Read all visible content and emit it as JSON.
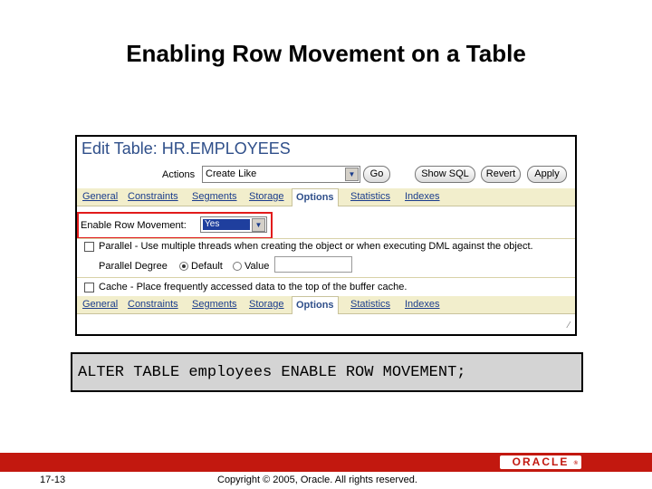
{
  "slide": {
    "title": "Enabling Row Movement on a Table",
    "page_number": "17-13",
    "copyright": "Copyright © 2005, Oracle.  All rights reserved.",
    "logo_text": "ORACLE"
  },
  "screenshot": {
    "title": "Edit Table: HR.EMPLOYEES",
    "actions_label": "Actions",
    "actions_value": "Create Like",
    "buttons": {
      "go": "Go",
      "show_sql": "Show SQL",
      "revert": "Revert",
      "apply": "Apply"
    },
    "tabs": [
      "General",
      "Constraints",
      "Segments",
      "Storage",
      "Options",
      "Statistics",
      "Indexes"
    ],
    "active_tab": "Options",
    "row_movement_label": "Enable Row Movement:",
    "row_movement_value": "Yes",
    "parallel_text": "Parallel - Use multiple threads when creating the object or when executing DML against the object.",
    "parallel_degree_label": "Parallel Degree",
    "default_label": "Default",
    "value_label": "Value",
    "cache_text": "Cache - Place frequently accessed data to the top of the buffer cache."
  },
  "sql_statement": "ALTER TABLE employees ENABLE ROW MOVEMENT;",
  "colors": {
    "accent_red": "#c2180f",
    "highlight_box": "#e21b1b",
    "tab_bar": "#f2eecc",
    "link_blue": "#1a3c8c"
  }
}
